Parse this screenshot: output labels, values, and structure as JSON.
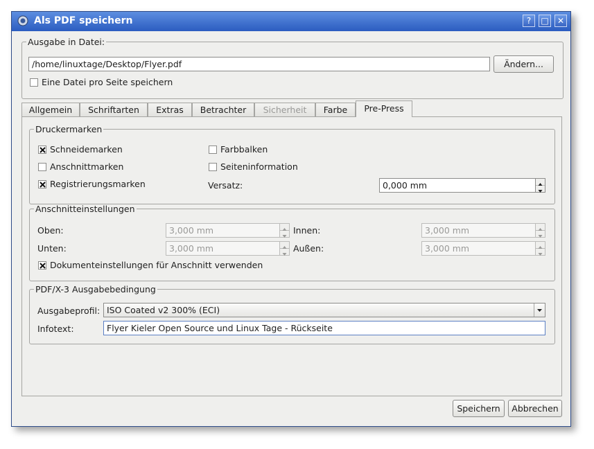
{
  "window": {
    "title": "Als PDF speichern",
    "buttons": {
      "help": "?",
      "maximize": "□",
      "close": "✕"
    }
  },
  "output": {
    "legend": "Ausgabe in Datei:",
    "path_value": "/home/linuxtage/Desktop/Flyer.pdf",
    "change_label": "Ändern...",
    "per_page_label": "Eine Datei pro Seite speichern",
    "per_page_checked": false
  },
  "tabs": [
    {
      "label": "Allgemein",
      "enabled": true,
      "active": false
    },
    {
      "label": "Schriftarten",
      "enabled": true,
      "active": false
    },
    {
      "label": "Extras",
      "enabled": true,
      "active": false
    },
    {
      "label": "Betrachter",
      "enabled": true,
      "active": false
    },
    {
      "label": "Sicherheit",
      "enabled": false,
      "active": false
    },
    {
      "label": "Farbe",
      "enabled": true,
      "active": false
    },
    {
      "label": "Pre-Press",
      "enabled": true,
      "active": true
    }
  ],
  "marks": {
    "legend": "Druckermarken",
    "crop": {
      "label": "Schneidemarken",
      "checked": true
    },
    "bleed": {
      "label": "Anschnittmarken",
      "checked": false
    },
    "registration": {
      "label": "Registrierungsmarken",
      "checked": true
    },
    "color_bars": {
      "label": "Farbbalken",
      "checked": false
    },
    "page_info": {
      "label": "Seiteninformation",
      "checked": false
    },
    "offset_label": "Versatz:",
    "offset_value": "0,000 mm"
  },
  "bleed": {
    "legend": "Anschnitteinstellungen",
    "top_label": "Oben:",
    "top_value": "3,000 mm",
    "bottom_label": "Unten:",
    "bottom_value": "3,000 mm",
    "inside_label": "Innen:",
    "inside_value": "3,000 mm",
    "outside_label": "Außen:",
    "outside_value": "3,000 mm",
    "use_doc_label": "Dokumenteinstellungen für Anschnitt verwenden",
    "use_doc_checked": true
  },
  "pdfx": {
    "legend": "PDF/X-3 Ausgabebedingung",
    "profile_label": "Ausgabeprofil:",
    "profile_value": "ISO Coated v2 300% (ECI)",
    "info_label": "Infotext:",
    "info_value": "Flyer Kieler Open Source und Linux Tage - Rückseite"
  },
  "footer": {
    "save_label": "Speichern",
    "cancel_label": "Abbrechen"
  }
}
